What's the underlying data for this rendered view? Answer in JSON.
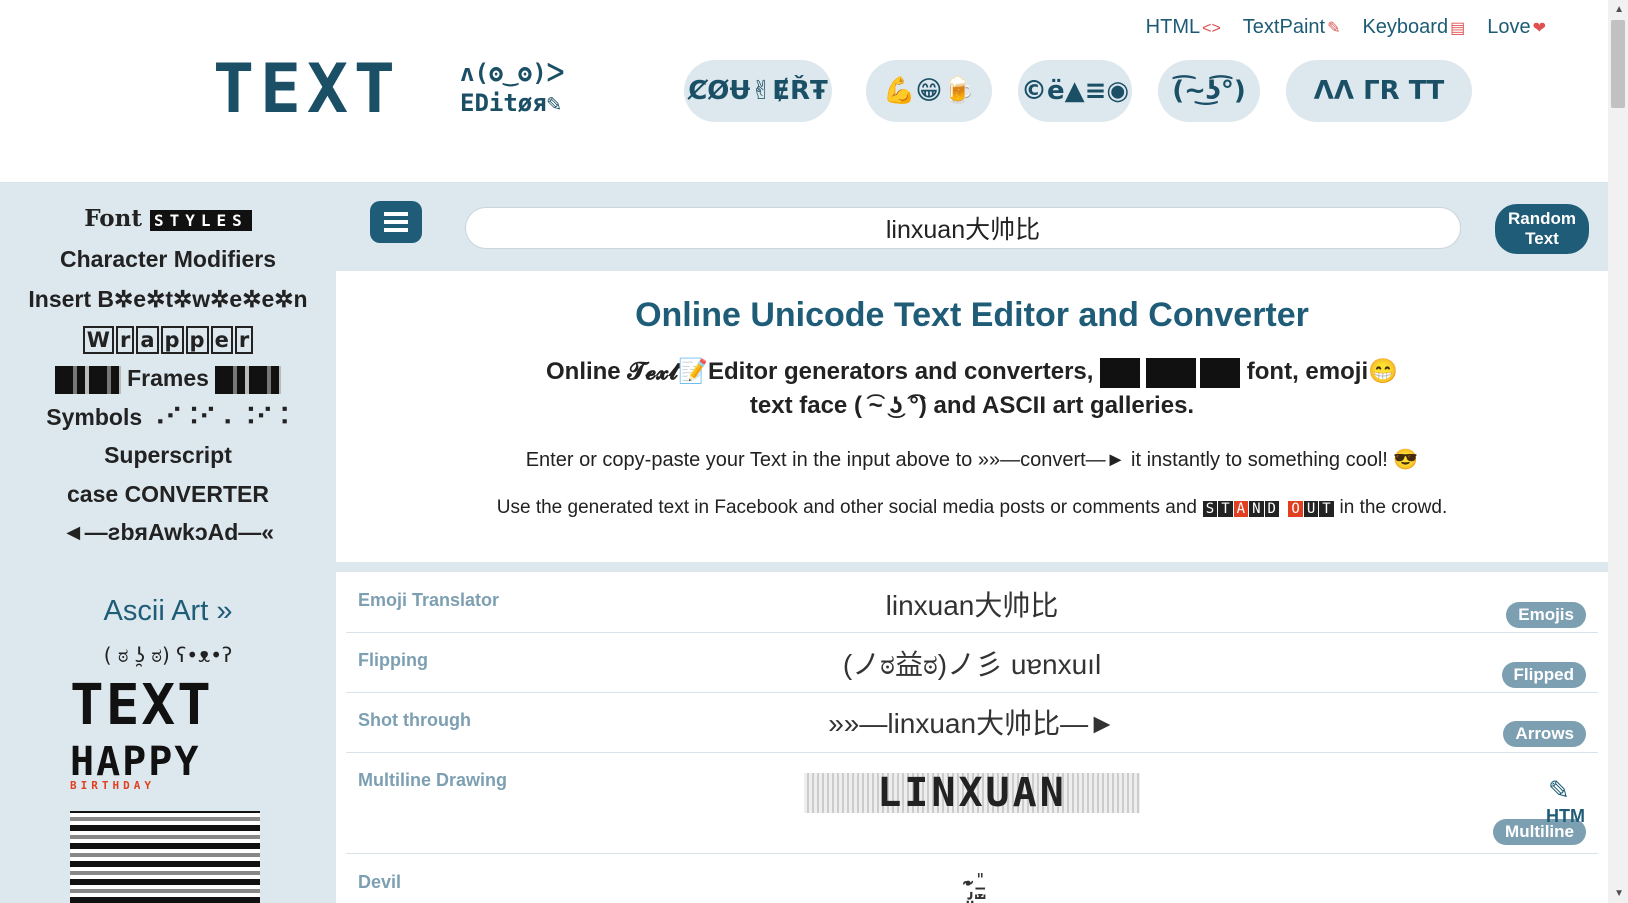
{
  "toplinks": [
    {
      "label": "HTML",
      "glyph": "<>"
    },
    {
      "label": "TextPaint",
      "glyph": "✎"
    },
    {
      "label": "Keyboard",
      "glyph": "▤"
    },
    {
      "label": "Love",
      "glyph": "❤"
    }
  ],
  "logo": {
    "text": "TEXT",
    "side1": "ʌ(ʘ‿ʘ)ᐳ",
    "side2": "EDitøя✎"
  },
  "header_pills": [
    "ȻØɄ✌ɆŘŦ",
    "💪😁🍺",
    "©ë▲≡◉",
    "(͡~͜ʖ͡°)",
    "ΛΛ ΓR ΤΤ"
  ],
  "sidebar": {
    "font_styles_prefix": "Font",
    "font_styles_box": "STYLES",
    "character_modifiers": "Character Modifiers",
    "insert_between": "Insert B✲e✲t✲w✲e✲e✲n",
    "wrapper_letters": [
      "W",
      "r",
      "a",
      "p",
      "p",
      "e",
      "r"
    ],
    "frames": "Frames",
    "symbols": "Symbols ⠠⠊⠨⠊⠠ ⠨⠊⠨",
    "superscript": "Superscript",
    "case_converter": "case CONVERTER",
    "backwards": "◄—ƨbяAwkɔAd—«",
    "ascii_title": "Ascii Art »",
    "ascii_face": "( ಠ ʖ̯ ಠ)  ʕ•ᴥ•ʔ",
    "ascii_text": "TEXT",
    "ascii_happy": "HAPPY",
    "ascii_birthday": "BIRTHDAY"
  },
  "input": {
    "value": "linxuan大帅比"
  },
  "random_button": "Random Text",
  "intro": {
    "title": "Online Unicode Text Editor and Converter",
    "line1_a": "Online 𝓣𝓮𝔁𝓽📝Editor generators and converters,",
    "line1_b": "font, emoji😁",
    "line2": "text face ( ͡~ ͜ʖ ͡°) and ASCII art galleries.",
    "line3": "Enter or copy-paste your Text in the input above to »»—convert—► it instantly to something cool! 😎",
    "line4_a": "Use the generated text in Facebook and other social media posts or comments and",
    "standout": [
      "S",
      "T",
      "A",
      "N",
      "D",
      " ",
      "O",
      "U",
      "T"
    ],
    "line4_b": "in the crowd."
  },
  "rows": [
    {
      "label": "Emoji Translator",
      "value": "linxuan大帅比",
      "tag": "Emojis"
    },
    {
      "label": "Flipping",
      "value": "(ノಠ益ಠ)ノ彡 uɐnxuıl",
      "tag": "Flipped"
    },
    {
      "label": "Shot through",
      "value": "»»—linxuan大帅比—►",
      "tag": "Arrows"
    },
    {
      "label": "Multiline Drawing",
      "value": "LINXUAN",
      "tag": "Multiline"
    },
    {
      "label": "Devil",
      "value": "ꞏ̴̡͈ ̵̗̞̺̎",
      "tag": ""
    }
  ],
  "htm_label": "HTM"
}
